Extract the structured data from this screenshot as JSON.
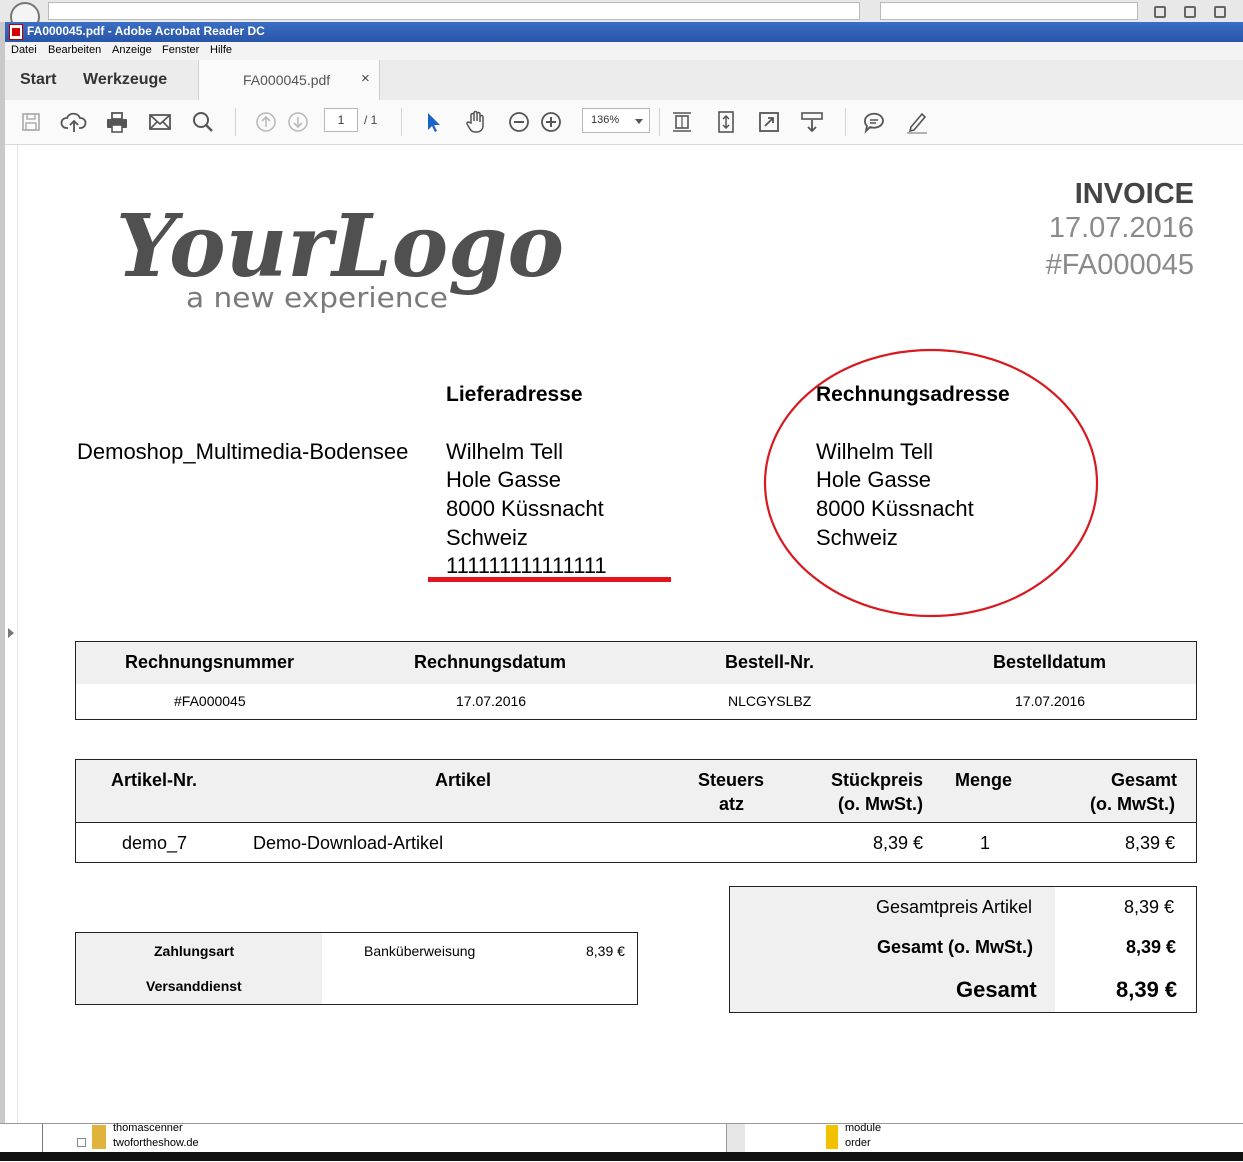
{
  "window": {
    "title": "FA000045.pdf - Adobe Acrobat Reader DC"
  },
  "menu": [
    "Datei",
    "Bearbeiten",
    "Anzeige",
    "Fenster",
    "Hilfe"
  ],
  "tabs": {
    "start": "Start",
    "tools": "Werkzeuge",
    "document": "FA000045.pdf",
    "close_glyph": "×"
  },
  "toolbar": {
    "page_current": "1",
    "page_total": "/ 1",
    "zoom": "136%",
    "icons": [
      "save-icon",
      "upload-icon",
      "print-icon",
      "mail-icon",
      "search-icon",
      "page-up-icon",
      "page-down-icon",
      "select-arrow-icon",
      "hand-icon",
      "zoom-out-icon",
      "zoom-in-icon",
      "fit-page-icon",
      "scroll-mode-icon",
      "fullscreen-icon",
      "read-mode-icon",
      "comment-icon",
      "sign-icon"
    ]
  },
  "invoice": {
    "logo_main": "YourLogo",
    "logo_tagline": "a new experience",
    "title": "INVOICE",
    "date": "17.07.2016",
    "number": "#FA000045",
    "shop": "Demoshop_Multimedia-Bodensee",
    "delivery": {
      "heading": "Lieferadresse",
      "lines": [
        "Wilhelm Tell",
        "Hole Gasse",
        "8000 Küssnacht",
        "Schweiz",
        "111111111111111"
      ]
    },
    "billing": {
      "heading": "Rechnungsadresse",
      "lines": [
        "Wilhelm Tell",
        "Hole Gasse",
        "8000 Küssnacht",
        "Schweiz"
      ]
    },
    "meta_table": {
      "headers": [
        "Rechnungsnummer",
        "Rechnungsdatum",
        "Bestell-Nr.",
        "Bestelldatum"
      ],
      "values": [
        "#FA000045",
        "17.07.2016",
        "NLCGYSLBZ",
        "17.07.2016"
      ]
    },
    "items_table": {
      "headers": {
        "article_no": "Artikel-Nr.",
        "article": "Artikel",
        "tax_1": "Steuers",
        "tax_2": "atz",
        "unit_1": "Stückpreis",
        "unit_2": "(o. MwSt.)",
        "qty": "Menge",
        "total_1": "Gesamt",
        "total_2": "(o. MwSt.)"
      },
      "row": {
        "article_no": "demo_7",
        "article": "Demo-Download-Artikel",
        "tax": "",
        "unit": "8,39 €",
        "qty": "1",
        "total": "8,39 €"
      }
    },
    "payment": {
      "label_payment": "Zahlungsart",
      "label_shipping": "Versanddienst",
      "payment_value": "Banküberweisung",
      "payment_amount": "8,39 €"
    },
    "totals": {
      "items_label": "Gesamtpreis Artikel",
      "items_value": "8,39 €",
      "net_label": "Gesamt (o. MwSt.)",
      "net_value": "8,39 €",
      "gross_label": "Gesamt",
      "gross_value": "8,39 €"
    },
    "annotation_colors": {
      "ellipse": "#d71920",
      "underline": "#e3141b"
    }
  },
  "explorer": {
    "left_items": [
      "thomascenner",
      "twofortheshow.de"
    ],
    "right_items": [
      "module",
      "order"
    ]
  }
}
